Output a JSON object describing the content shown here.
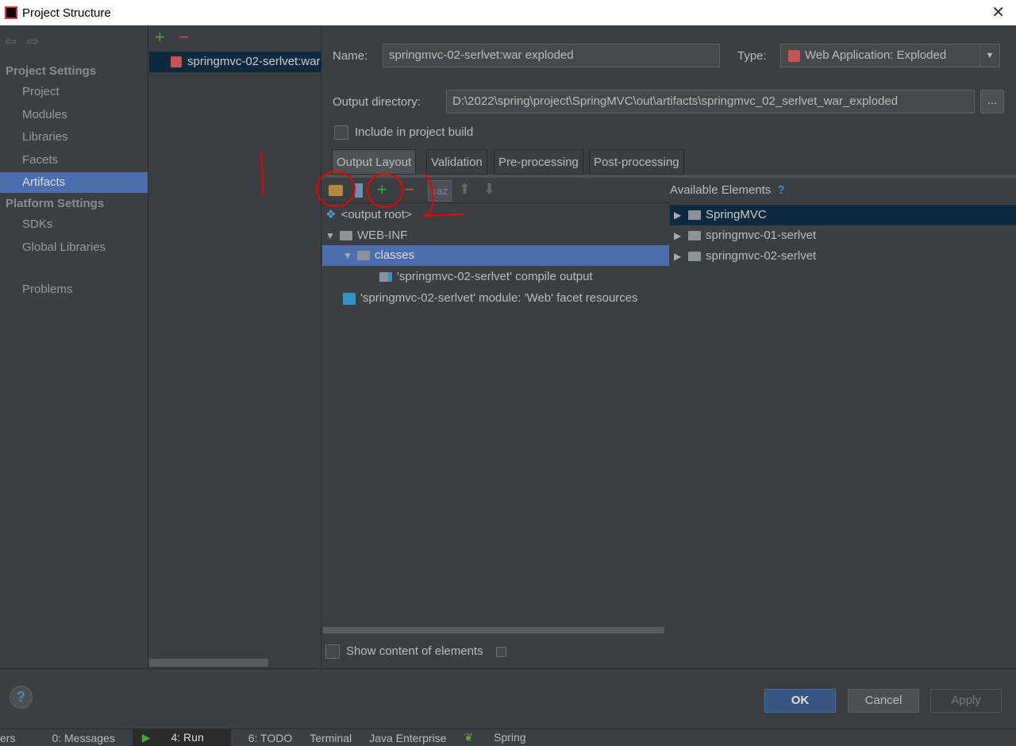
{
  "window": {
    "title": "Project Structure",
    "close": "✕"
  },
  "nav": {
    "back": "⇦",
    "forward": "⇨"
  },
  "sidebar": {
    "project_settings": "Project Settings",
    "items": [
      {
        "label": "Project"
      },
      {
        "label": "Modules"
      },
      {
        "label": "Libraries"
      },
      {
        "label": "Facets"
      },
      {
        "label": "Artifacts",
        "selected": true
      }
    ],
    "platform_settings": "Platform Settings",
    "platform_items": [
      {
        "label": "SDKs"
      },
      {
        "label": "Global Libraries"
      }
    ],
    "problems": "Problems"
  },
  "artifacts": {
    "add": "+",
    "remove": "−",
    "list": [
      "springmvc-02-serlvet:war exploded"
    ]
  },
  "form": {
    "name_label": "Name:",
    "name_value": "springmvc-02-serlvet:war exploded",
    "type_label": "Type:",
    "type_value": "Web Application: Exploded",
    "output_label": "Output directory:",
    "output_value": "D:\\2022\\spring\\project\\SpringMVC\\out\\artifacts\\springmvc_02_serlvet_war_exploded",
    "browse": "...",
    "include_label": "Include in project build"
  },
  "tabs": [
    "Output Layout",
    "Validation",
    "Pre-processing",
    "Post-processing"
  ],
  "layout_tree": [
    {
      "label": "<output root>"
    },
    {
      "label": "WEB-INF"
    },
    {
      "label": "classes",
      "selected": true
    },
    {
      "label": "'springmvc-02-serlvet' compile output"
    },
    {
      "label": "'springmvc-02-serlvet' module: 'Web' facet resources"
    }
  ],
  "available": {
    "title": "Available Elements",
    "help": "?",
    "items": [
      "SpringMVC",
      "springmvc-01-serlvet",
      "springmvc-02-serlvet"
    ]
  },
  "show_content": "Show content of elements",
  "buttons": {
    "help": "?",
    "ok": "OK",
    "cancel": "Cancel",
    "apply": "Apply"
  },
  "toolwindows": [
    "ers",
    "0: Messages",
    "4: Run",
    "6: TODO",
    "Terminal",
    "Java Enterprise",
    "Spring"
  ],
  "annotations": {
    "number_one": "1"
  }
}
